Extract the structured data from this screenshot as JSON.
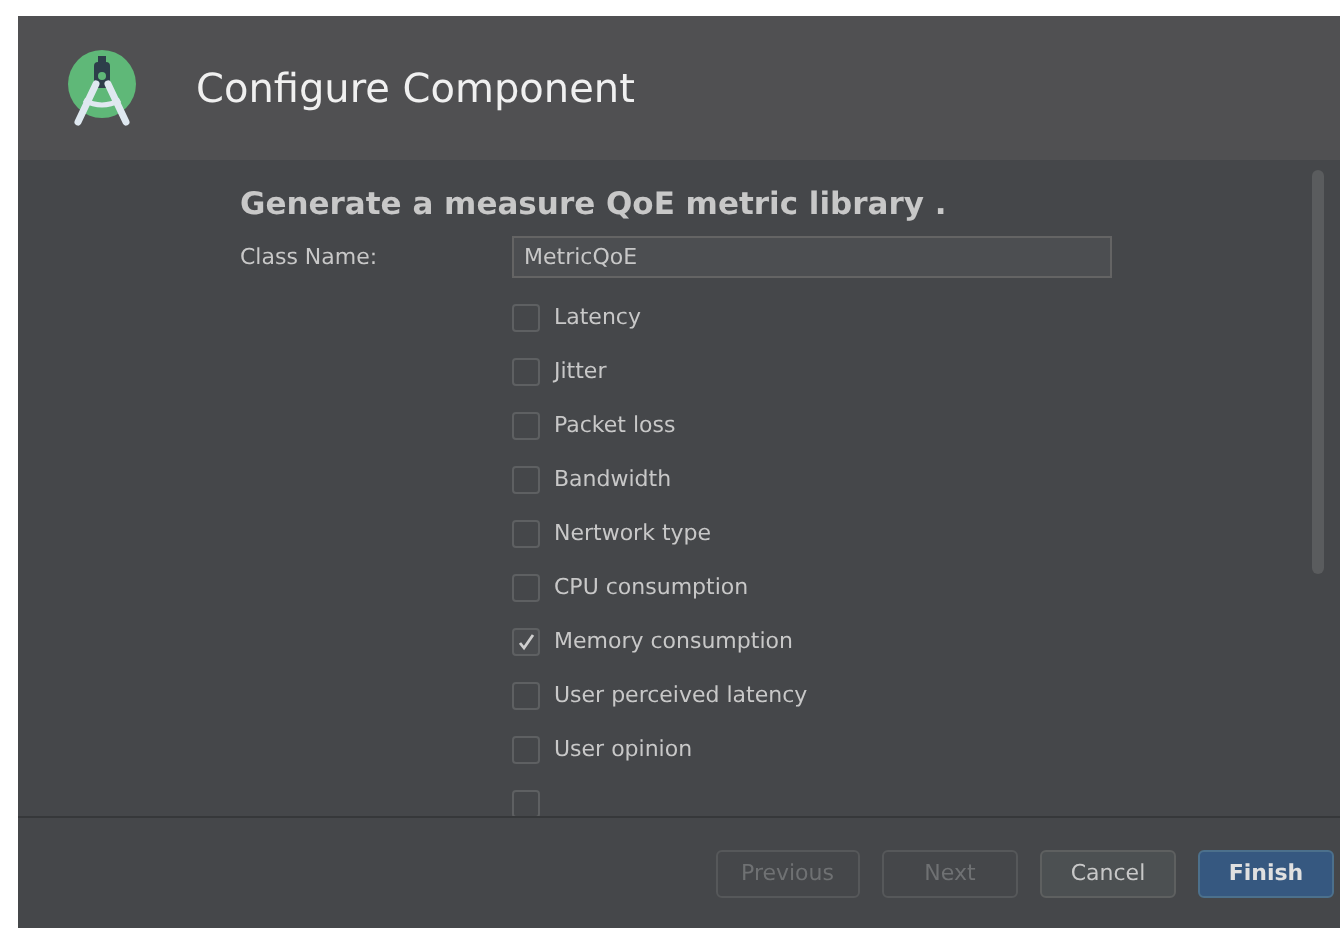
{
  "window": {
    "title": "Configure Component"
  },
  "heading": "Generate a measure QoE metric library .",
  "class_name": {
    "label": "Class Name:",
    "value": "MetricQoE"
  },
  "options": [
    {
      "label": "Latency",
      "checked": false
    },
    {
      "label": "Jitter",
      "checked": false
    },
    {
      "label": "Packet loss",
      "checked": false
    },
    {
      "label": "Bandwidth",
      "checked": false
    },
    {
      "label": "Nertwork type",
      "checked": false
    },
    {
      "label": "CPU consumption",
      "checked": false
    },
    {
      "label": "Memory consumption",
      "checked": true
    },
    {
      "label": "User perceived latency",
      "checked": false
    },
    {
      "label": "User opinion",
      "checked": false
    },
    {
      "checked": false
    }
  ],
  "buttons": [
    {
      "label": "Previous",
      "disabled": true,
      "default": false
    },
    {
      "label": "Next",
      "disabled": true,
      "default": false
    },
    {
      "label": "Cancel",
      "disabled": false,
      "default": false
    },
    {
      "label": "Finish",
      "disabled": false,
      "default": true
    }
  ]
}
